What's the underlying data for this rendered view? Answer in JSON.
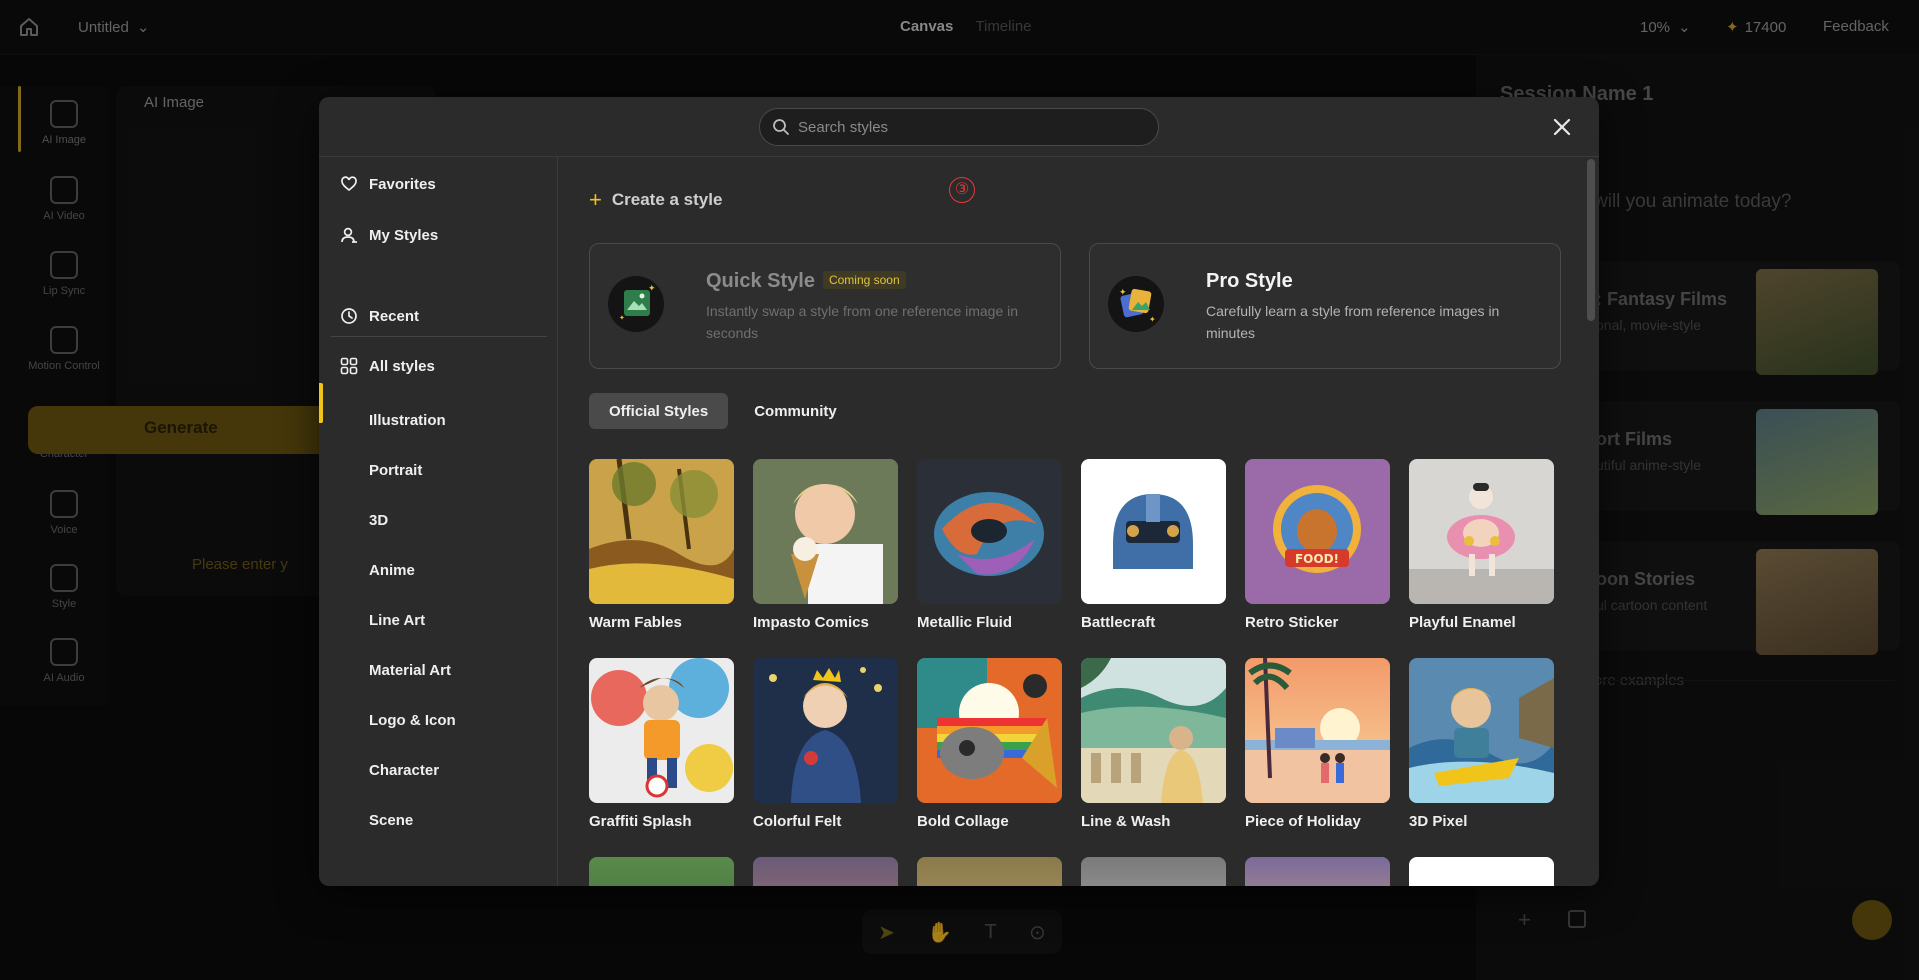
{
  "topbar": {
    "project_name": "Untitled",
    "tab_canvas": "Canvas",
    "tab_timeline": "Timeline",
    "zoom": "10%",
    "credits": "17400",
    "feedback": "Feedback"
  },
  "rail": {
    "items": [
      {
        "label": "AI Image"
      },
      {
        "label": "AI Video"
      },
      {
        "label": "Lip Sync"
      },
      {
        "label": "Motion Control"
      },
      {
        "label": "Character"
      },
      {
        "label": "Voice"
      },
      {
        "label": "Style"
      },
      {
        "label": "AI Audio"
      }
    ]
  },
  "bg_panel": {
    "title": "AI Image",
    "generate_label": "Generate",
    "warning": "Please enter y"
  },
  "right_panel": {
    "session_name": "Session Name 1",
    "question": "will you animate today?",
    "cards": [
      {
        "title": ": Fantasy Films",
        "sub": "onal, movie-style"
      },
      {
        "title": "ort Films",
        "sub": "utiful anime-style"
      },
      {
        "title": "oon Stories",
        "sub": "ul cartoon content"
      }
    ],
    "more": "ore examples"
  },
  "modal": {
    "search_placeholder": "Search styles",
    "sidebar": {
      "favorites": "Favorites",
      "my_styles": "My Styles",
      "recent": "Recent",
      "all_styles": "All styles",
      "categories": [
        "Illustration",
        "Portrait",
        "3D",
        "Anime",
        "Line Art",
        "Material Art",
        "Logo & Icon",
        "Character",
        "Scene"
      ]
    },
    "create_label": "Create a style",
    "annotation": "③",
    "quick_style": {
      "title": "Quick Style",
      "badge": "Coming soon",
      "desc": "Instantly swap a style from one reference image in seconds"
    },
    "pro_style": {
      "title": "Pro Style",
      "desc": "Carefully learn a style from reference images in minutes"
    },
    "tabs": {
      "official": "Official Styles",
      "community": "Community"
    },
    "styles": [
      "Warm Fables",
      "Impasto Comics",
      "Metallic Fluid",
      "Battlecraft",
      "Retro Sticker",
      "Playful Enamel",
      "Graffiti Splash",
      "Colorful Felt",
      "Bold Collage",
      "Line & Wash",
      "Piece of Holiday",
      "3D Pixel"
    ],
    "accent_color": "#f0c419"
  }
}
